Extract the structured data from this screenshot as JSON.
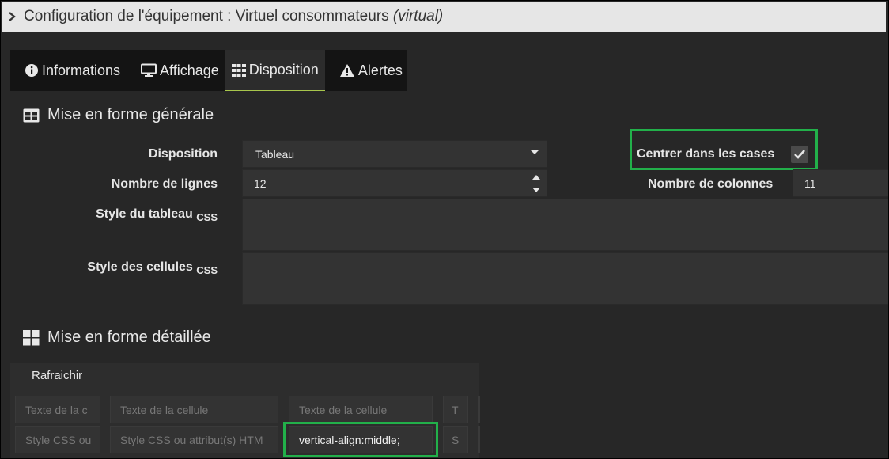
{
  "header": {
    "title_main": "Configuration de l'équipement : Virtuel consommateurs ",
    "title_suffix": "(virtual)"
  },
  "tabs": [
    {
      "label": "Informations",
      "icon": "info-circle-icon"
    },
    {
      "label": "Affichage",
      "icon": "monitor-icon"
    },
    {
      "label": "Disposition",
      "icon": "grid-icon",
      "active": true
    },
    {
      "label": "Alertes",
      "icon": "warning-icon"
    }
  ],
  "general": {
    "section_title": "Mise en forme générale",
    "disposition_label": "Disposition",
    "disposition_value": "Tableau",
    "center_label": "Centrer dans les cases",
    "center_checked": true,
    "rows_label": "Nombre de lignes",
    "rows_value": "12",
    "cols_label": "Nombre de colonnes",
    "cols_value": "11",
    "table_style_label": "Style du tableau",
    "cell_style_label": "Style des cellules",
    "css_suffix": "CSS"
  },
  "detailed": {
    "section_title": "Mise en forme détaillée",
    "refresh_label": "Rafraichir",
    "row1": [
      "Texte de la c",
      "Texte de la cellule",
      "Texte de la cellule",
      "T"
    ],
    "row2": [
      "Style CSS ou",
      "Style CSS ou attribut(s) HTM",
      "vertical-align:middle;",
      "S"
    ]
  },
  "colors": {
    "highlight": "#22b04a",
    "active_tab_underline": "#a8c64c"
  }
}
